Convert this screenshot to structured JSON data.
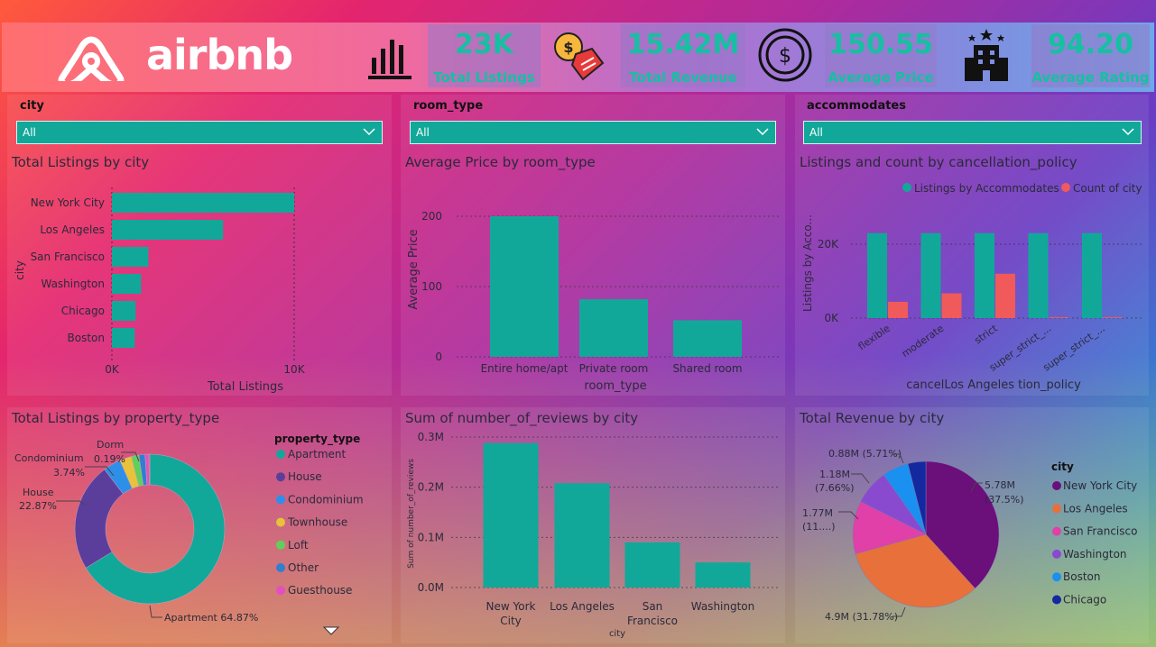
{
  "brand": {
    "name": "airbnb"
  },
  "kpis": [
    {
      "value": "23K",
      "label": "Total Listings",
      "icon": "bar-chart-icon"
    },
    {
      "value": "15.42M",
      "label": "Total Revenue",
      "icon": "price-tag-icon"
    },
    {
      "value": "150.55",
      "label": "Average Price",
      "icon": "dollar-coin-icon"
    },
    {
      "value": "94.20",
      "label": "Average Rating",
      "icon": "hotel-building-icon"
    }
  ],
  "slicers": [
    {
      "label": "city",
      "value": "All"
    },
    {
      "label": "room_type",
      "value": "All"
    },
    {
      "label": "accommodates",
      "value": "All"
    }
  ],
  "colors": {
    "teal": "#11a89a",
    "coral": "#f05a5a",
    "kpi_text": "#16c0a0"
  },
  "chart_data": [
    {
      "type": "bar",
      "orientation": "horizontal",
      "title": "Total Listings by city",
      "xlabel": "Total Listings",
      "ylabel": "city",
      "categories": [
        "New York City",
        "Los Angeles",
        "San Francisco",
        "Washington",
        "Chicago",
        "Boston"
      ],
      "values": [
        10000,
        6100,
        2000,
        1600,
        1300,
        1250
      ],
      "xlim": [
        0,
        10500
      ],
      "xticks": [
        "0K",
        "10K"
      ]
    },
    {
      "type": "bar",
      "title": "Average Price by room_type",
      "xlabel": "room_type",
      "ylabel": "Average Price",
      "categories": [
        "Entire home/apt",
        "Private room",
        "Shared room"
      ],
      "values": [
        200,
        82,
        52
      ],
      "ylim": [
        0,
        220
      ],
      "yticks": [
        "0",
        "100",
        "200"
      ]
    },
    {
      "type": "bar",
      "title": "Listings and count by cancellation_policy",
      "xlabel": "cancelLos Angeles tion_policy",
      "ylabel": "Listings by Acco...",
      "categories": [
        "flexible",
        "moderate",
        "strict",
        "super_strict_...",
        "super_strict_..."
      ],
      "series": [
        {
          "name": "Listings by Accommodates",
          "values": [
            23000,
            23000,
            23000,
            23000,
            23000
          ]
        },
        {
          "name": "Count of city",
          "values": [
            4400,
            6700,
            12000,
            250,
            250
          ]
        }
      ],
      "ylim": [
        0,
        28000
      ],
      "yticks": [
        "0K",
        "20K"
      ],
      "legend": "top"
    },
    {
      "type": "pie",
      "donut": true,
      "title": "Total Listings by property_type",
      "legend_title": "property_type",
      "labels": [
        "Apartment",
        "House",
        "Condominium",
        "Townhouse",
        "Loft",
        "Other",
        "Guesthouse",
        "Dorm"
      ],
      "values": [
        64.87,
        22.87,
        3.74,
        2.5,
        1.6,
        1.3,
        0.8,
        0.19
      ],
      "legend_items": [
        "Apartment",
        "House",
        "Condominium",
        "Townhouse",
        "Loft",
        "Other",
        "Guesthouse"
      ],
      "annotations": [
        "Dorm",
        "0.19%",
        "Condominium",
        "3.74%",
        "House",
        "22.87%",
        "Apartment 64.87%"
      ]
    },
    {
      "type": "bar",
      "title": "Sum of number_of_reviews by city",
      "xlabel": "city",
      "ylabel": "Sum of number_of_reviews",
      "categories": [
        "New York City",
        "Los Angeles",
        "San Francisco",
        "Washington"
      ],
      "values": [
        288000,
        208000,
        90000,
        50000
      ],
      "ylim": [
        0,
        310000
      ],
      "yticks": [
        "0.0M",
        "0.1M",
        "0.2M",
        "0.3M"
      ]
    },
    {
      "type": "pie",
      "title": "Total Revenue by city",
      "legend_title": "city",
      "labels": [
        "New York City",
        "Los Angeles",
        "San Francisco",
        "Washington",
        "Boston",
        "Chicago"
      ],
      "values": [
        5.78,
        4.9,
        1.77,
        1.18,
        0.88,
        0.6
      ],
      "slice_labels": [
        "5.78M (37.5%)",
        "4.9M (31.78%)",
        "1.77M (11....)",
        "1.18M (7.66%)",
        "0.88M (5.71%)",
        ""
      ]
    }
  ]
}
